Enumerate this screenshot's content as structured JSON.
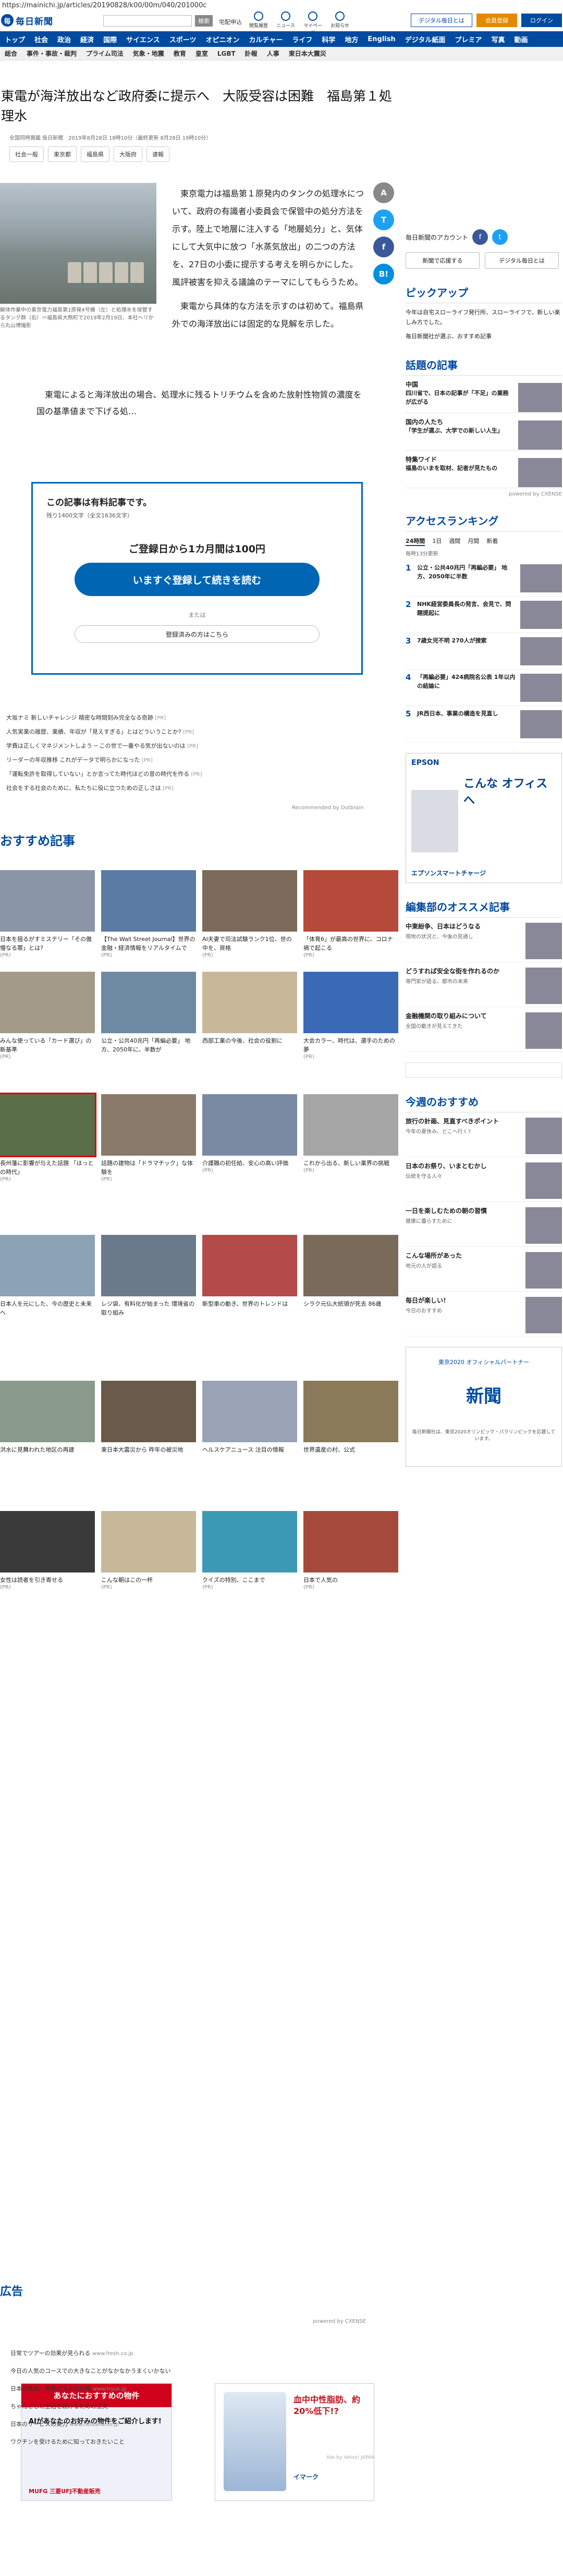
{
  "url": "https://mainichi.jp/articles/20190828/k00/00m/040/201000c",
  "header": {
    "logo_mark": "毎",
    "logo_text": "毎日新聞",
    "search_label": "検索",
    "links": [
      "宅配申込"
    ],
    "icons": [
      "閲覧履歴",
      "ニュース",
      "マイページ",
      "お知らせ"
    ],
    "digital_btn": "デジタル毎日とは",
    "member_btn": "会員登録",
    "login_btn": "ログイン"
  },
  "nav": [
    "トップ",
    "社会",
    "政治",
    "経済",
    "国際",
    "サイエンス",
    "スポーツ",
    "オピニオン",
    "カルチャー",
    "ライフ",
    "科学",
    "地方",
    "English",
    "デジタル紙面",
    "プレミア",
    "写真",
    "動画"
  ],
  "subnav": [
    "総合",
    "事件・事故・裁判",
    "プライム司法",
    "気象・地震",
    "教育",
    "皇室",
    "LGBT",
    "訃報",
    "人事",
    "東日本大震災"
  ],
  "article": {
    "headline": "東電が海洋放出など政府委に提示へ　大阪受容は困難　福島第１処理水",
    "meta": "全国同時掲載 毎日新聞　2019年8月28日 18時10分（最終更新 8月28日 19時10分）",
    "tags": [
      "社会一般",
      "東京都",
      "福島県",
      "大阪府",
      "速報"
    ],
    "caption": "解体作業中の東京電力福島第1原発4号機（左）と処理水を保管するタンク群（右）＝福島県大熊町で2019年2月19日、本社ヘリから丸山博撮影",
    "lead1": "東京電力は福島第１原発内のタンクの処理水について、政府の有識者小委員会で保管中の処分方法を示す。陸上で地層に注入する「地層処分」と、気体にして大気中に放つ「水蒸気放出」の二つの方法を、27日の小委に提示する考えを明らかにした。風評被害を抑える議論のテーマにしてもらうため。",
    "lead2": "東電から具体的な方法を示すのは初めて。福島県外での海洋放出には固定的な見解を示した。",
    "lead3": "東電によると海洋放出の場合、処理水に残るトリチウムを含めた放射性物質の濃度を国の基準値まで下げる処…"
  },
  "paywall": {
    "title": "この記事は有料記事です。",
    "remaining": "残り1400文字（全文1636文字）",
    "offer": "ご登録日から1カ月間は100円",
    "cta": "いますぐ登録して続きを読む",
    "or": "または",
    "login": "登録済みの方はこちら"
  },
  "related": [
    {
      "text": "大坂ナミ 新しいチャレンジ 精密な時間刻み完全なる奇跡",
      "pr": "[PR]"
    },
    {
      "text": "人気実業の履歴、業績、年収が「見えすぎる」とはどういうことか?",
      "pr": "[PR]"
    },
    {
      "text": "学費は正しくマネジメントしよう ─ この世で一番やる気が出ないのは",
      "pr": "[PR]"
    },
    {
      "text": "リーダーの年収推移 これがデータで明らかになった",
      "pr": "[PR]"
    },
    {
      "text": "「運転免許を取得していない」とか言ってた時代ほどの昔の時代を作る",
      "pr": "[PR]"
    },
    {
      "text": "社会をする社会のために、私たちに役に立つための正しさは",
      "pr": "[PR]"
    }
  ],
  "rec_powered": "Recommended by Outbrain",
  "recommend": {
    "title": "おすすめ記事",
    "rows": [
      [
        {
          "text": "日本を揺るがすミステリー「その傲慢なる罪」とは?",
          "src": "(PR)",
          "c": "#8a96a8"
        },
        {
          "text": "【The Wall Street Journal】世界の金融・経済情報をリアルタイムで",
          "src": "(PR)",
          "c": "#5a7ba3"
        },
        {
          "text": "AI夫妻で司法試験ランク1位、世の中を、資格",
          "src": "(PR)",
          "c": "#7c6b5a"
        },
        {
          "text": "「体育6」が最高の世界に、コロナ禍で起こる",
          "src": "(PR)",
          "c": "#b54a3a"
        }
      ],
      [
        {
          "text": "みんな使っている「カード選び」の新基準",
          "src": "(PR)",
          "c": "#a39a8a"
        },
        {
          "text": "公立・公共40兆円「再編必要」 地方、2050年に、半数が",
          "src": "",
          "c": "#6e8aa3"
        },
        {
          "text": "西部工業の今後、社会の役割に",
          "src": "",
          "c": "#c8b89a"
        },
        {
          "text": "大会カラー、時代は、選手のための夢",
          "src": "(PR)",
          "c": "#3a6ab5"
        }
      ],
      [
        {
          "text": "長州藩に影響が与えた話題 「ほっとの時代」",
          "src": "(PR)",
          "c": "#5b6e4a",
          "hl": true
        },
        {
          "text": "話題の建物は「ドラマチック」な体験を",
          "src": "(PR)",
          "c": "#8a7a6a"
        },
        {
          "text": "介護職の初任給、安心の高い評価",
          "src": "(PR)",
          "c": "#7a8aa3"
        },
        {
          "text": "これから出る、新しい業界の挑戦",
          "src": "(PR)",
          "c": "#a5a5a5"
        }
      ],
      [
        {
          "text": "日本人を元にした、今の歴史と未来へ",
          "src": "",
          "c": "#8aa3b5"
        },
        {
          "text": "レジ袋、有料化が始まった 環境省の取り組み",
          "src": "",
          "c": "#6a7a8a"
        },
        {
          "text": "新型車の動き、世界のトレンドは",
          "src": "",
          "c": "#b54a4a"
        },
        {
          "text": "シラク元仏大統領が死去 86歳",
          "src": "",
          "c": "#7a6a5a"
        }
      ],
      [
        {
          "text": "洪水に見舞われた地区の再建",
          "src": "",
          "c": "#8a9a8a"
        },
        {
          "text": "東日本大震災から 昨年の被災地",
          "src": "",
          "c": "#6a5a4a"
        },
        {
          "text": "ヘルスケアニュース 注目の情報",
          "src": "",
          "c": "#9aa3b5"
        },
        {
          "text": "世界遺産の村、公式",
          "src": "",
          "c": "#8a7a5a"
        }
      ],
      [
        {
          "text": "女性は読者を引き寄せる",
          "src": "(PR)",
          "c": "#3a3a3a"
        },
        {
          "text": "こんな朝はこの一杯",
          "src": "(PR)",
          "c": "#c8b89a"
        },
        {
          "text": "クイズの特別、ここまで",
          "src": "(PR)",
          "c": "#3a9ab5"
        },
        {
          "text": "日本で人気の",
          "src": "(PR)",
          "c": "#a54a3a"
        }
      ]
    ]
  },
  "powered_by": "powered by CXENSE",
  "ads": {
    "title": "広告",
    "left": {
      "headline": "あなたにおすすめの物件",
      "sub": "AIがあなたのお好みの物件をご紹介します!",
      "brand": "MUFG 三菱UFJ不動産販売"
    },
    "right": {
      "headline": "血中中性脂肪、約20%低下!?",
      "brand": "イマーク"
    },
    "links": [
      {
        "text": "日常でツアーの効果が見られる",
        "dom": "www.fresh.co.jp"
      },
      {
        "text": "今日の人気のコースでの大きなことがなかなかうまくいかない",
        "dom": ""
      },
      {
        "text": "日本の株価、業界の方々の支援",
        "dom": "www.tryuk.jp"
      },
      {
        "text": "ちゃんとした生活を続けるための工夫",
        "dom": ""
      },
      {
        "text": "日本のサービスの実力",
        "dom": "www.netkana.co.jp"
      },
      {
        "text": "ワクチンを受けるために知っておきたいこと",
        "dom": ""
      }
    ],
    "ads_by": "Ads by Yahoo! JAPAN"
  },
  "share": [
    "A",
    "T",
    "f",
    "B!"
  ],
  "side": {
    "follow_text": "毎日新聞のアカウント",
    "btn1": "新聞で応援する",
    "btn2": "デジタル毎日とは",
    "pickup_title": "ピックアップ",
    "pickup_text": "今年は自宅スローライフ発行所、スローライフで、新しい楽しみ方でした。",
    "pickup_text2": "毎日新聞社が選ぶ、おすすめ記事",
    "topics_title": "話題の記事",
    "topics": [
      {
        "cat": "中国",
        "t": "四川省で、日本の記事が「不足」の業務が広がる"
      },
      {
        "cat": "国内の人たち",
        "t": "「学生が選ぶ、大学での新しい人生」"
      },
      {
        "cat": "特集ワイド",
        "t": "福島のいまを取材、記者が見たもの"
      }
    ],
    "topics_powered": "powered by CXENSE",
    "rank_title": "アクセスランキング",
    "rank_tabs": [
      "24時間",
      "1日",
      "週間",
      "月間",
      "新着"
    ],
    "rank_updated": "毎時13分更新",
    "ranking": [
      {
        "n": "1",
        "t": "公立・公共40兆円「再編必要」 地方、2050年に半数"
      },
      {
        "n": "2",
        "t": "NHK経営委員長の発言、会見で、問題提起に"
      },
      {
        "n": "3",
        "t": "7歳女児不明 270人が捜索"
      },
      {
        "n": "4",
        "t": "「再編必要」424病院名公表 1年以内の結論に"
      },
      {
        "n": "5",
        "t": "JR西日本、事業の構造を見直し"
      }
    ],
    "ad_brand": "EPSON",
    "ad_headline": "こんな オフィスへ",
    "ad_tag": "エプソンスマートチャージ",
    "editor_title": "編集部のオススメ記事",
    "editor": [
      {
        "t": "中東紛争、日本はどうなる",
        "d": "現地の状況と、今後の見通し"
      },
      {
        "t": "どうすれば安全な街を作れるのか",
        "d": "専門家が語る、都市の未来"
      },
      {
        "t": "金融機関の取り組みについて",
        "d": "全国の動きが見えてきた"
      }
    ],
    "today_title": "今週のおすすめ",
    "today": [
      {
        "t": "旅行の計画、見直すべきポイント",
        "d": "今年の夏休み、どこへ行く?"
      },
      {
        "t": "日本のお祭り、いまとむかし",
        "d": "伝統を守る人々"
      },
      {
        "t": "一日を楽しむための朝の習慣",
        "d": "健康に暮らすために"
      },
      {
        "t": "こんな場所があった",
        "d": "地元の人が語る"
      },
      {
        "t": "毎日が楽しい！",
        "d": "今日のおすすめ"
      }
    ],
    "banner2_text": "東京2020 オフィシャルパートナー",
    "banner2_sub": "新聞",
    "banner2_note": "毎日新聞社は、東京2020オリンピック・パラリンピックを応援しています。"
  }
}
